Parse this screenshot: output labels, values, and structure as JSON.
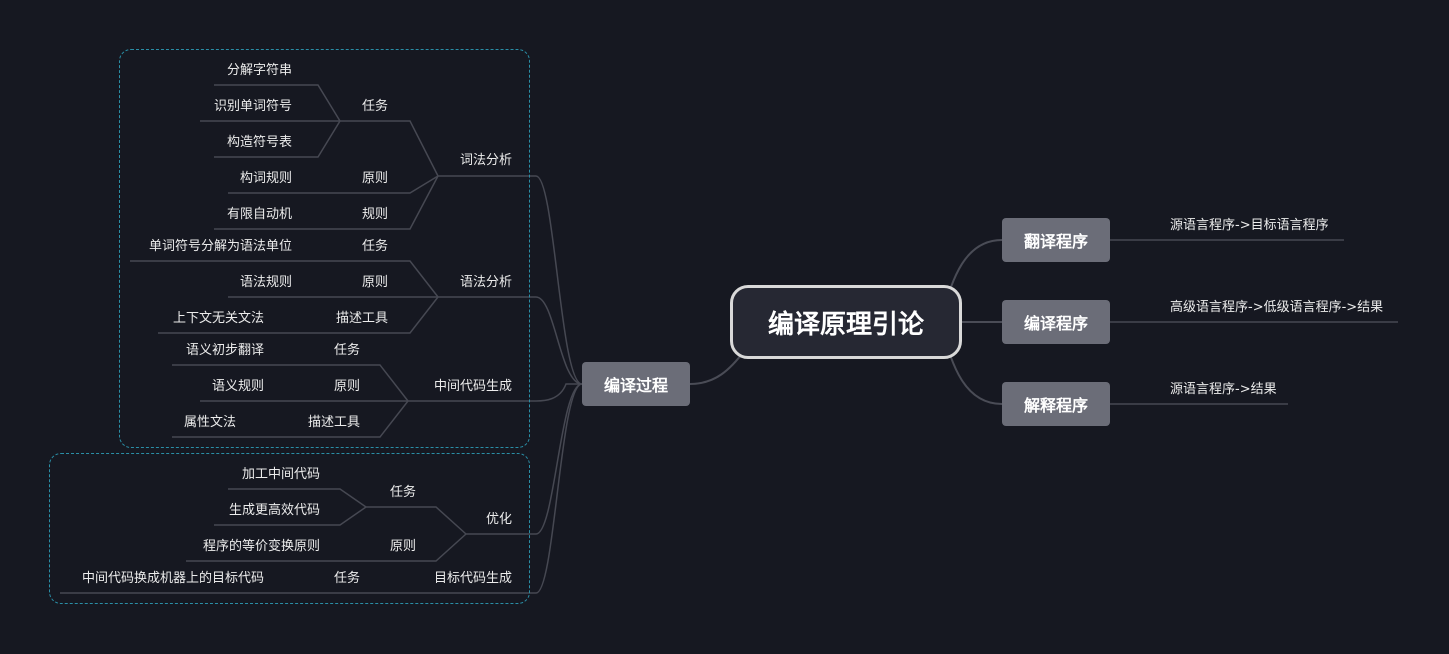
{
  "root": "编译原理引论",
  "right_branches": [
    {
      "title": "翻译程序",
      "detail": "源语言程序->目标语言程序"
    },
    {
      "title": "编译程序",
      "detail": "高级语言程序->低级语言程序->结果"
    },
    {
      "title": "解释程序",
      "detail": "源语言程序->结果"
    }
  ],
  "left_branch": {
    "title": "编译过程",
    "lexical": {
      "title": "词法分析",
      "task": "任务",
      "task_items": [
        "分解字符串",
        "识别单词符号",
        "构造符号表"
      ],
      "principle": "原则",
      "principle_item": "构词规则",
      "rule": "规则",
      "rule_item": "有限自动机"
    },
    "syntax": {
      "title": "语法分析",
      "task": "任务",
      "task_item": "单词符号分解为语法单位",
      "principle": "原则",
      "principle_item": "语法规则",
      "tool": "描述工具",
      "tool_item": "上下文无关文法"
    },
    "intermediate": {
      "title": "中间代码生成",
      "task": "任务",
      "task_item": "语义初步翻译",
      "principle": "原则",
      "principle_item": "语义规则",
      "tool": "描述工具",
      "tool_item": "属性文法"
    },
    "optimize": {
      "title": "优化",
      "task": "任务",
      "task_items": [
        "加工中间代码",
        "生成更高效代码"
      ],
      "principle": "原则",
      "principle_item": "程序的等价变换原则"
    },
    "target": {
      "title": "目标代码生成",
      "task": "任务",
      "task_item": "中间代码换成机器上的目标代码"
    }
  }
}
